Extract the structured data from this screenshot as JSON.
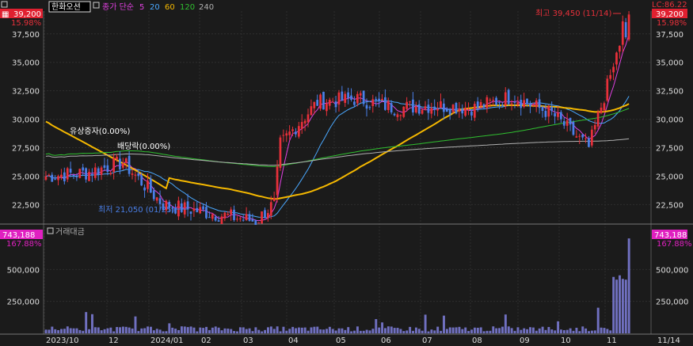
{
  "header": {
    "stock_name": "한화오션",
    "legend_label": "종가 단순",
    "ma_periods": [
      "5",
      "20",
      "60",
      "120",
      "240"
    ],
    "ma_colors": [
      "#e040e0",
      "#4aa8ff",
      "#f5b800",
      "#30c030",
      "#b0b0b0"
    ]
  },
  "price_panel": {
    "current_price": "39,200",
    "current_change_pct": "15.98%",
    "right_top_label": "LC:86.22",
    "high_annotation": "최고 39,450 (11/14)",
    "low_annotation": "최저 21,050 (01/25)",
    "event_1": "유상증자(0.00%)",
    "event_2": "배당락(0.00%)"
  },
  "volume_panel": {
    "title": "거래대금",
    "current_value": "743,188",
    "current_pct": "167.88%"
  },
  "colors": {
    "background": "#1b1b1b",
    "up_candle": "#e8303a",
    "down_candle": "#4a7fe8",
    "volume_bar": "#7070c0",
    "price_badge": "#e02030",
    "volume_badge": "#e020c0"
  },
  "chart_data": [
    {
      "type": "candlestick",
      "title": "한화오션",
      "y_ticks": [
        "22,500",
        "25,000",
        "27,500",
        "30,000",
        "32,500",
        "35,000",
        "37,500"
      ],
      "ylim": [
        21000,
        39500
      ],
      "x_ticks": [
        "2023/10",
        "12",
        "2024/01",
        "02",
        "03",
        "04",
        "05",
        "06",
        "07",
        "08",
        "09",
        "10",
        "11",
        "11/14"
      ],
      "approx_close_path": [
        {
          "date": "2023-10",
          "close": 25000
        },
        {
          "date": "2023-11",
          "close": 25300
        },
        {
          "date": "2023-12",
          "close": 26200
        },
        {
          "date": "2024-01",
          "close": 22500
        },
        {
          "date": "2024-01-25",
          "close": 21050
        },
        {
          "date": "2024-02",
          "close": 22600
        },
        {
          "date": "2024-03",
          "close": 27800
        },
        {
          "date": "2024-04",
          "close": 31500
        },
        {
          "date": "2024-05",
          "close": 31800
        },
        {
          "date": "2024-06",
          "close": 31000
        },
        {
          "date": "2024-07",
          "close": 31200
        },
        {
          "date": "2024-08",
          "close": 31000
        },
        {
          "date": "2024-09",
          "close": 32000
        },
        {
          "date": "2024-10",
          "close": 30500
        },
        {
          "date": "2024-11",
          "close": 27500
        },
        {
          "date": "2024-11-14",
          "close": 39200
        }
      ],
      "high": {
        "value": 39450,
        "date": "11/14"
      },
      "low": {
        "value": 21050,
        "date": "01/25"
      }
    },
    {
      "type": "bar",
      "title": "거래대금",
      "y_ticks": [
        "250,000",
        "500,000"
      ],
      "ylim": [
        0,
        750000
      ],
      "last_value": 743188
    }
  ]
}
